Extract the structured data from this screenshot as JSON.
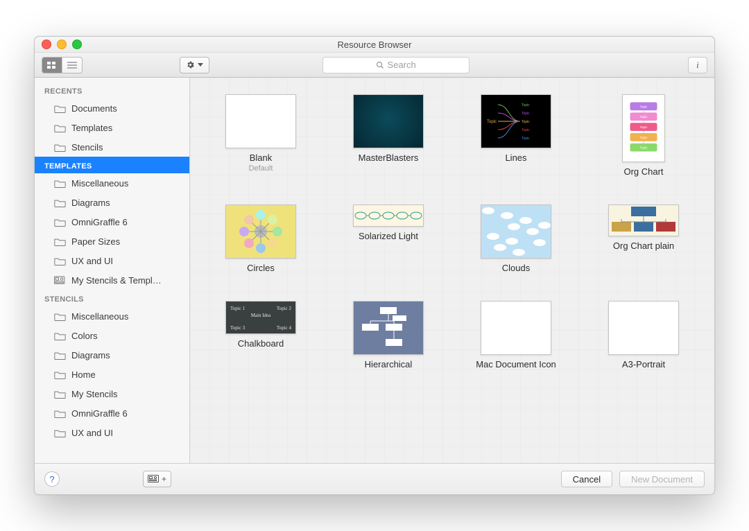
{
  "window_title": "Resource Browser",
  "toolbar": {
    "search_placeholder": "Search"
  },
  "sidebar": {
    "sections": [
      {
        "header": "RECENTS",
        "selected": false,
        "items": [
          {
            "label": "Documents",
            "icon": "folder"
          },
          {
            "label": "Templates",
            "icon": "folder"
          },
          {
            "label": "Stencils",
            "icon": "folder"
          }
        ]
      },
      {
        "header": "TEMPLATES",
        "selected": true,
        "items": [
          {
            "label": "Miscellaneous",
            "icon": "folder"
          },
          {
            "label": "Diagrams",
            "icon": "folder"
          },
          {
            "label": "OmniGraffle 6",
            "icon": "folder"
          },
          {
            "label": "Paper Sizes",
            "icon": "folder"
          },
          {
            "label": "UX and UI",
            "icon": "folder"
          },
          {
            "label": "My Stencils & Templ…",
            "icon": "stencil"
          }
        ]
      },
      {
        "header": "STENCILS",
        "selected": false,
        "items": [
          {
            "label": "Miscellaneous",
            "icon": "folder"
          },
          {
            "label": "Colors",
            "icon": "folder"
          },
          {
            "label": "Diagrams",
            "icon": "folder"
          },
          {
            "label": "Home",
            "icon": "folder"
          },
          {
            "label": "My Stencils",
            "icon": "folder"
          },
          {
            "label": "OmniGraffle 6",
            "icon": "folder"
          },
          {
            "label": "UX and UI",
            "icon": "folder"
          }
        ]
      }
    ]
  },
  "templates": [
    {
      "label": "Blank",
      "sub": "Default",
      "style": "blank"
    },
    {
      "label": "MasterBlasters",
      "style": "dark"
    },
    {
      "label": "Lines",
      "style": "lines"
    },
    {
      "label": "Org Chart",
      "style": "orgchart"
    },
    {
      "label": "Circles",
      "style": "circles"
    },
    {
      "label": "Solarized Light",
      "style": "solarized"
    },
    {
      "label": "Clouds",
      "style": "clouds"
    },
    {
      "label": "Org Chart plain",
      "style": "orgchartplain"
    },
    {
      "label": "Chalkboard",
      "style": "chalk"
    },
    {
      "label": "Hierarchical",
      "style": "hier"
    },
    {
      "label": "Mac Document Icon",
      "style": "blank"
    },
    {
      "label": "A3-Portrait",
      "style": "blank"
    }
  ],
  "footer": {
    "cancel": "Cancel",
    "new_document": "New Document"
  }
}
